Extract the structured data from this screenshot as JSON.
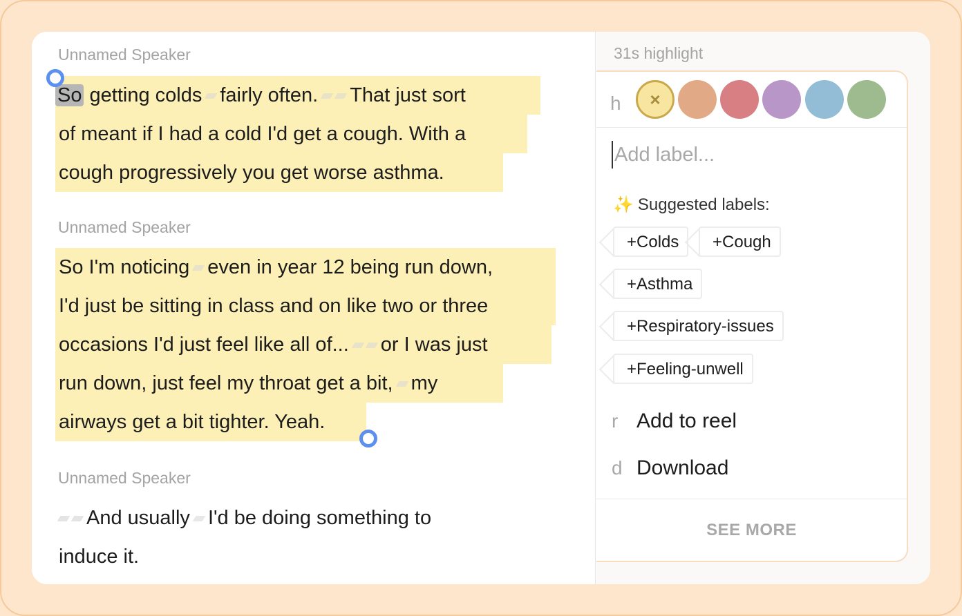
{
  "transcript": {
    "blocks": [
      {
        "speaker": "Unnamed Speaker",
        "lines": [
          {
            "a": "So",
            "b": " getting colds",
            "c": "fairly often.",
            "d": "That just sort"
          },
          {
            "text": "of meant if I had a cold I'd get a cough. With a"
          },
          {
            "text": "cough progressively you get worse asthma."
          }
        ]
      },
      {
        "speaker": "Unnamed Speaker",
        "lines": [
          {
            "a": "So I'm noticing",
            "b": "even in year 12 being run down,"
          },
          {
            "text": "I'd just be sitting in class and on like two or three"
          },
          {
            "a": "occasions I'd just feel like all of...",
            "b": "or I was just"
          },
          {
            "a": "run down, just feel my throat get a bit,",
            "b": "my"
          },
          {
            "text": "airways get a bit tighter. Yeah."
          }
        ]
      },
      {
        "speaker": "Unnamed Speaker",
        "lines": [
          {
            "a": "And usually",
            "b": "I'd be doing something to"
          },
          {
            "text": "induce it."
          }
        ]
      }
    ]
  },
  "panel": {
    "title": "31s highlight",
    "color_key": "h",
    "colors": [
      {
        "name": "yellow",
        "hex": "#f8e6a0",
        "selected": true,
        "icon": "close-icon",
        "glyph": "×"
      },
      {
        "name": "orange",
        "hex": "#e1a985"
      },
      {
        "name": "red",
        "hex": "#d77f82"
      },
      {
        "name": "purple",
        "hex": "#b996c8"
      },
      {
        "name": "blue",
        "hex": "#93bcd6"
      },
      {
        "name": "green",
        "hex": "#9dbb8f"
      }
    ],
    "label_placeholder": "Add label...",
    "suggested_title": "Suggested labels:",
    "suggested_icon": "sparkles-icon",
    "tags": [
      "+Colds",
      "+Cough",
      "+Asthma",
      "+Respiratory-issues",
      "+Feeling-unwell"
    ],
    "actions": [
      {
        "key": "r",
        "label": "Add to reel"
      },
      {
        "key": "d",
        "label": "Download"
      }
    ],
    "see_more": "SEE MORE"
  }
}
